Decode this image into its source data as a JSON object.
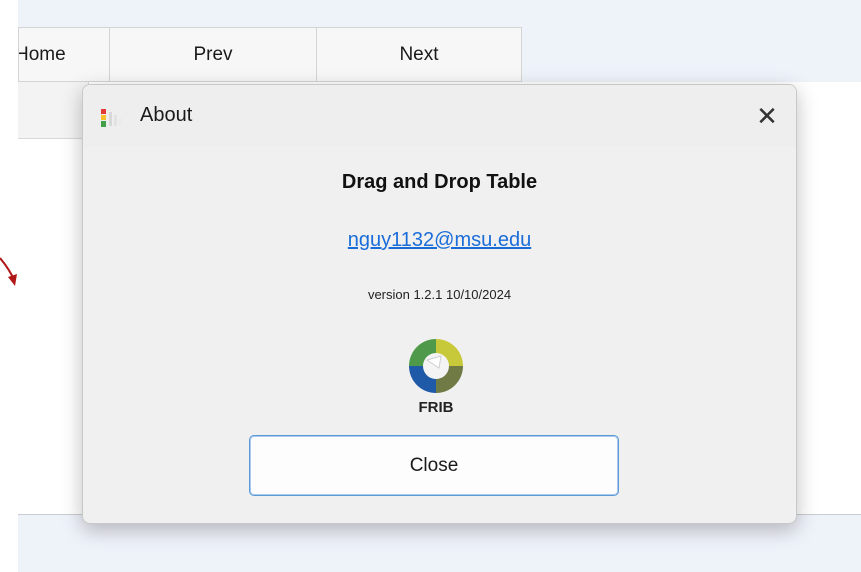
{
  "background": {
    "nav": {
      "home_label": "Home",
      "prev_label": "Prev",
      "next_label": "Next"
    }
  },
  "dialog": {
    "title": "About",
    "close_glyph": "✕",
    "app_name": "Drag and Drop Table",
    "email": "nguy1132@msu.edu",
    "version": "version 1.2.1 10/10/2024",
    "logo_text": "FRIB",
    "close_button_label": "Close",
    "accent_color": "#1a6dd8"
  }
}
